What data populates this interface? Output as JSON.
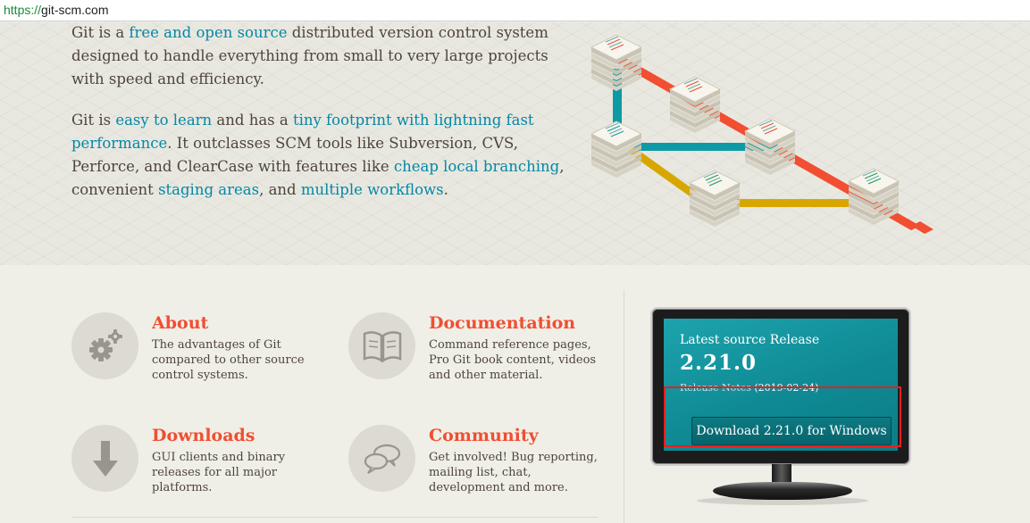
{
  "browser": {
    "url_protocol": "https://",
    "url_host": "git-scm.com"
  },
  "hero": {
    "p1": {
      "t1": "Git is a ",
      "link1": "free and open source",
      "t2": " distributed version control system designed to handle everything from small to very large projects with speed and efficiency."
    },
    "p2": {
      "t1": "Git is ",
      "link1": "easy to learn",
      "t2": " and has a ",
      "link2": "tiny footprint with lightning fast performance",
      "t3": ". It outclasses SCM tools like Subversion, CVS, Perforce, and ClearCase with features like ",
      "link3": "cheap local branching",
      "t4": ", convenient ",
      "link4": "staging areas",
      "t5": ", and ",
      "link5": "multiple workflows",
      "t6": "."
    }
  },
  "features": [
    {
      "title": "About",
      "desc": "The advantages of Git compared to other source control systems.",
      "icon": "gears-icon"
    },
    {
      "title": "Documentation",
      "desc": "Command reference pages, Pro Git book content, videos and other material.",
      "icon": "book-icon"
    },
    {
      "title": "Downloads",
      "desc": "GUI clients and binary releases for all major platforms.",
      "icon": "download-arrow-icon"
    },
    {
      "title": "Community",
      "desc": "Get involved! Bug reporting, mailing list, chat, development and more.",
      "icon": "speech-bubbles-icon"
    }
  ],
  "release": {
    "label": "Latest source Release",
    "version": "2.21.0",
    "notes_link": "Release Notes",
    "date": "(2019-02-24)",
    "download_button": "Download 2.21.0 for Windows"
  },
  "colors": {
    "accent": "#f14e32",
    "link": "#0388a6",
    "screen": "#1199a3",
    "branch_red": "#f14e32",
    "branch_teal": "#0e9aa4",
    "branch_yellow": "#d7a700",
    "highlight": "#e52020"
  }
}
